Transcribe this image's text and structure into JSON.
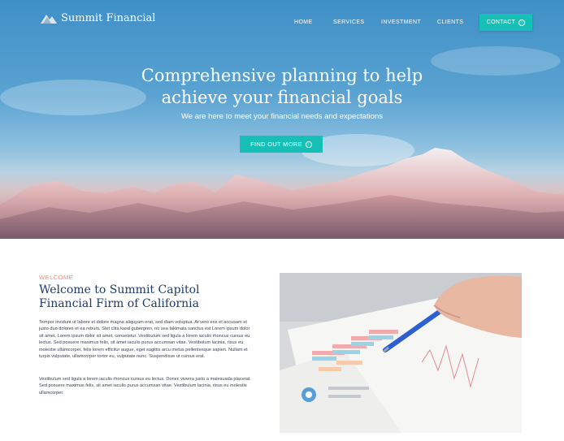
{
  "brand": {
    "name": "Summit Financial",
    "logo_icon": "mountain-logo-icon"
  },
  "nav": {
    "links": [
      "HOME",
      "SERVICES",
      "INVESTMENT",
      "CLIENTS"
    ],
    "contact_label": "CONTACT"
  },
  "hero": {
    "headline_line1": "Comprehensive planning to help",
    "headline_line2": "achieve your financial goals",
    "subheading": "We are here to meet your financial needs and expectations",
    "cta_label": "FIND OUT MORE"
  },
  "welcome": {
    "eyebrow": "WELCOME",
    "title_line1": "Welcome to Summit Capitol",
    "title_line2": "Financial Firm of California",
    "paragraph1": "Tempor invidunt ut labore et dolore magna aliquyam erat, sed diam voluptua. At vero eos et accusam et justo duo dolores et ea rebum. Stet clita kasd gubergren, no sea takimata sanctus est Lorem ipsum dolor sit amet. Lorem ipsum dolor sit amet, consetetur. Vestibulum sed ligula a lorem iaculis rhoncus cursus eu lectus. Sed posuere maximus felis, sit amet iaculis purus accumsan vitae. Vestibulum lacinia, risus eu molestie ullamcorper, felis lorem efficitur augue, eget sagittis arcu metus pellentesque sapien. Nullam et turpis vulputate, ullamcorper tortor eu, vulputate nunc. Suspendisse ut cursus erat.",
    "paragraph2": "Vestibulum sed ligula a lorem iaculis rhoncus cursus eu lectus. Donec viverra justo a malesuada placerat. Sed posuere maximus felis, sit amet iaculis purus accumsan vitae. Vestibulum lacinia, risus eu molestie ullamcorper."
  },
  "colors": {
    "accent": "#16c0b6",
    "navy": "#1f3c66",
    "coral": "#f08c7e"
  }
}
